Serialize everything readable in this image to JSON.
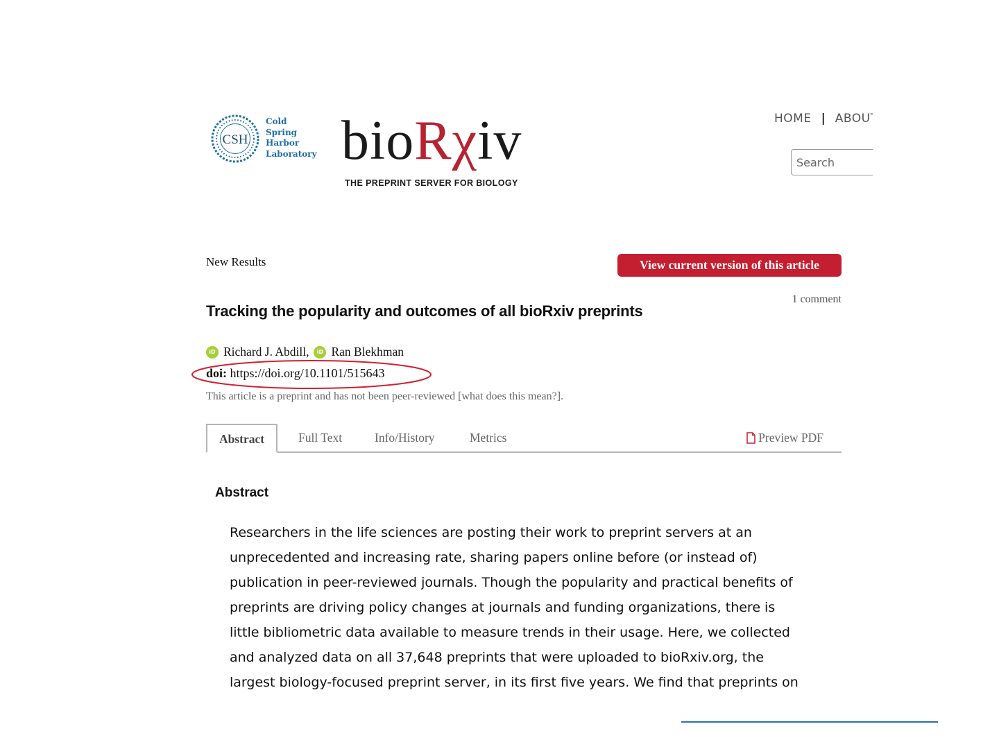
{
  "header": {
    "csh_logo_text": "CSH",
    "csh_lines": [
      "Cold",
      "Spring",
      "Harbor",
      "Laboratory"
    ],
    "wordmark_prefix": "bio",
    "wordmark_accent": "Rχ",
    "wordmark_suffix": "iv",
    "tagline": "THE PREPRINT SERVER FOR BIOLOGY",
    "nav_home": "HOME",
    "nav_separator": "|",
    "nav_about": "ABOUT",
    "search_placeholder": "Search"
  },
  "article": {
    "type_label": "New Results",
    "current_version_button": "View current version of this article",
    "comments": "1 comment",
    "title": "Tracking the popularity and outcomes of all bioRxiv preprints",
    "authors": [
      {
        "name": "Richard J. Abdill,",
        "orcid_icon": "orcid-icon"
      },
      {
        "name": "Ran Blekhman",
        "orcid_icon": "orcid-icon"
      }
    ],
    "orcid_glyph": "iD",
    "doi_label": "doi:",
    "doi_value": "https://doi.org/10.1101/515643",
    "peer_note": "This article is a preprint and has not been peer-reviewed [what does this mean?]."
  },
  "tabs": {
    "items": [
      "Abstract",
      "Full Text",
      "Info/History",
      "Metrics"
    ],
    "active": "Abstract",
    "pdf_label": "Preview PDF"
  },
  "abstract": {
    "heading": "Abstract",
    "lines": [
      "Researchers in the life sciences are posting their work to preprint servers at an",
      "unprecedented and increasing rate, sharing papers online before (or instead of)",
      "publication in peer-reviewed journals. Though the popularity and practical benefits of",
      "preprints are driving policy changes at journals and funding organizations, there is",
      "little bibliometric data available to measure trends in their usage. Here, we collected",
      "and analyzed data on all 37,648 preprints that were uploaded to bioRxiv.org, the",
      "largest biology-focused preprint server, in its first five years. We find that preprints on"
    ]
  },
  "colors": {
    "accent_red": "#c41f30",
    "csh_blue": "#1f6fa8",
    "orcid_green": "#a6ce39",
    "highlight_ellipse": "#d3202f",
    "rule_blue": "#2b6cb0"
  }
}
